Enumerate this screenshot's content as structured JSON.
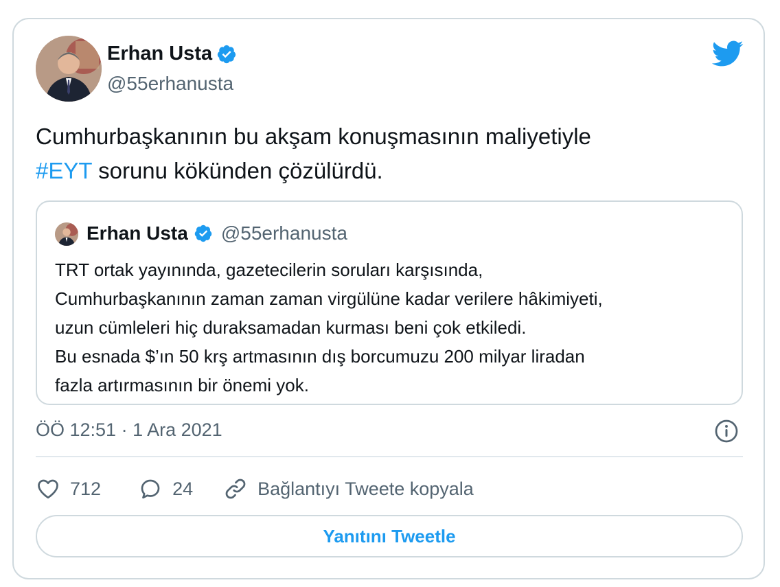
{
  "author": {
    "name": "Erhan Usta",
    "handle": "@55erhanusta",
    "verified": true
  },
  "tweet": {
    "text_before": "Cumhurbaşkanının bu akşam konuşmasının maliyetiyle",
    "hashtag": "#EYT",
    "text_after": " sorunu kökünden çözülürdü."
  },
  "quoted": {
    "name": "Erhan Usta",
    "handle": "@55erhanusta",
    "lines": [
      "TRT ortak yayınında, gazetecilerin soruları karşısında,",
      "Cumhurbaşkanının zaman zaman virgülüne kadar verilere hâkimiyeti,",
      "uzun cümleleri hiç duraksamadan kurması beni çok etkiledi.",
      "Bu esnada $’ın 50 krş artmasının dış borcumuzu 200 milyar liradan",
      "fazla artırmasının bir önemi yok."
    ]
  },
  "meta": {
    "timestamp": "ÖÖ 12:51 · 1 Ara 2021"
  },
  "actions": {
    "likes": "712",
    "replies": "24",
    "copy_link": "Bağlantıyı Tweete kopyala"
  },
  "reply_button": "Yanıtını Tweetle",
  "colors": {
    "accent": "#1d9bf0",
    "text": "#0f1419",
    "secondary": "#536471",
    "border": "#cfd9de"
  },
  "icons": [
    "verified-badge-icon",
    "twitter-bird-icon",
    "info-icon",
    "heart-icon",
    "reply-bubble-icon",
    "link-icon"
  ]
}
